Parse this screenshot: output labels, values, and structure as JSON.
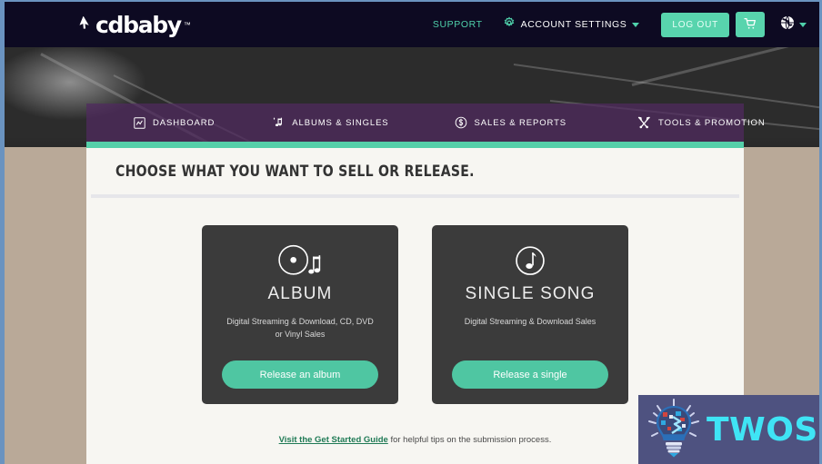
{
  "header": {
    "logo_text": "cdbaby",
    "logo_tm": "™",
    "support_label": "SUPPORT",
    "account_settings_label": "ACCOUNT SETTINGS",
    "logout_label": "LOG OUT",
    "cart_label": "cart",
    "globe_label": "language",
    "accent_teal": "#58d4ad",
    "bar_color": "#0d0a22"
  },
  "mainnav": {
    "items": [
      {
        "label": "DASHBOARD",
        "icon": "dashboard-icon"
      },
      {
        "label": "ALBUMS & SINGLES",
        "icon": "music-note-icon"
      },
      {
        "label": "SALES & REPORTS",
        "icon": "dollar-circle-icon"
      },
      {
        "label": "TOOLS & PROMOTION",
        "icon": "tools-icon"
      }
    ],
    "bar_color": "#502a60",
    "rule_color": "#55cfa9"
  },
  "main": {
    "page_title": "CHOOSE WHAT YOU WANT TO SELL OR RELEASE.",
    "cards": [
      {
        "icon": "vinyl-record-icon",
        "title": "ALBUM",
        "description": "Digital Streaming & Download, CD, DVD or Vinyl Sales",
        "button_label": "Release an album"
      },
      {
        "icon": "music-note-circle-icon",
        "title": "SINGLE SONG",
        "description": "Digital Streaming & Download Sales",
        "button_label": "Release a single"
      }
    ],
    "footnote_link": "Visit the Get Started Guide",
    "footnote_rest": " for helpful tips on the submission process.",
    "card_bg": "#3b3b3b",
    "button_color": "#4fc6a2",
    "panel_bg": "#f7f6f2"
  },
  "watermark": {
    "text": "TWOS",
    "icon": "lightbulb-icon",
    "bg": "#4e5280",
    "text_color": "#3fe4f5"
  }
}
